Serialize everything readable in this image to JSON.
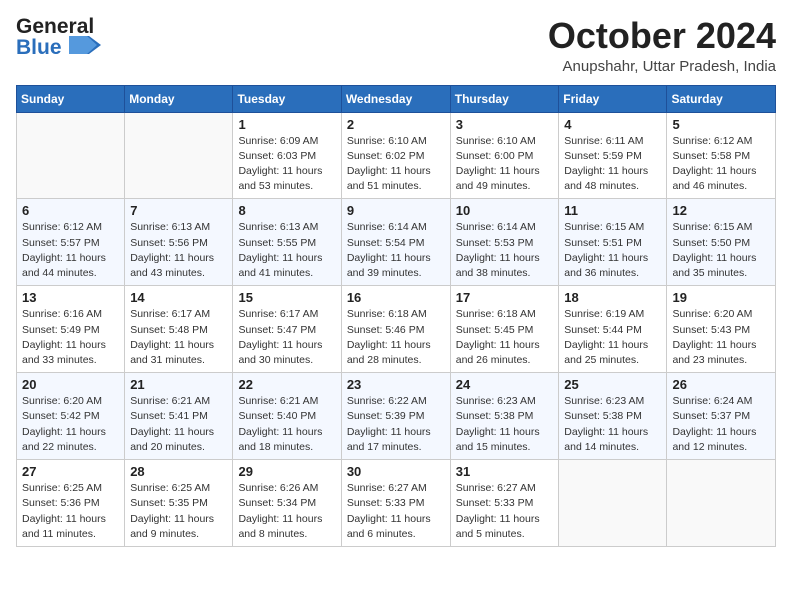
{
  "header": {
    "logo_general": "General",
    "logo_blue": "Blue",
    "month": "October 2024",
    "location": "Anupshahr, Uttar Pradesh, India"
  },
  "weekdays": [
    "Sunday",
    "Monday",
    "Tuesday",
    "Wednesday",
    "Thursday",
    "Friday",
    "Saturday"
  ],
  "weeks": [
    [
      {
        "day": "",
        "info": ""
      },
      {
        "day": "",
        "info": ""
      },
      {
        "day": "1",
        "info": "Sunrise: 6:09 AM\nSunset: 6:03 PM\nDaylight: 11 hours and 53 minutes."
      },
      {
        "day": "2",
        "info": "Sunrise: 6:10 AM\nSunset: 6:02 PM\nDaylight: 11 hours and 51 minutes."
      },
      {
        "day": "3",
        "info": "Sunrise: 6:10 AM\nSunset: 6:00 PM\nDaylight: 11 hours and 49 minutes."
      },
      {
        "day": "4",
        "info": "Sunrise: 6:11 AM\nSunset: 5:59 PM\nDaylight: 11 hours and 48 minutes."
      },
      {
        "day": "5",
        "info": "Sunrise: 6:12 AM\nSunset: 5:58 PM\nDaylight: 11 hours and 46 minutes."
      }
    ],
    [
      {
        "day": "6",
        "info": "Sunrise: 6:12 AM\nSunset: 5:57 PM\nDaylight: 11 hours and 44 minutes."
      },
      {
        "day": "7",
        "info": "Sunrise: 6:13 AM\nSunset: 5:56 PM\nDaylight: 11 hours and 43 minutes."
      },
      {
        "day": "8",
        "info": "Sunrise: 6:13 AM\nSunset: 5:55 PM\nDaylight: 11 hours and 41 minutes."
      },
      {
        "day": "9",
        "info": "Sunrise: 6:14 AM\nSunset: 5:54 PM\nDaylight: 11 hours and 39 minutes."
      },
      {
        "day": "10",
        "info": "Sunrise: 6:14 AM\nSunset: 5:53 PM\nDaylight: 11 hours and 38 minutes."
      },
      {
        "day": "11",
        "info": "Sunrise: 6:15 AM\nSunset: 5:51 PM\nDaylight: 11 hours and 36 minutes."
      },
      {
        "day": "12",
        "info": "Sunrise: 6:15 AM\nSunset: 5:50 PM\nDaylight: 11 hours and 35 minutes."
      }
    ],
    [
      {
        "day": "13",
        "info": "Sunrise: 6:16 AM\nSunset: 5:49 PM\nDaylight: 11 hours and 33 minutes."
      },
      {
        "day": "14",
        "info": "Sunrise: 6:17 AM\nSunset: 5:48 PM\nDaylight: 11 hours and 31 minutes."
      },
      {
        "day": "15",
        "info": "Sunrise: 6:17 AM\nSunset: 5:47 PM\nDaylight: 11 hours and 30 minutes."
      },
      {
        "day": "16",
        "info": "Sunrise: 6:18 AM\nSunset: 5:46 PM\nDaylight: 11 hours and 28 minutes."
      },
      {
        "day": "17",
        "info": "Sunrise: 6:18 AM\nSunset: 5:45 PM\nDaylight: 11 hours and 26 minutes."
      },
      {
        "day": "18",
        "info": "Sunrise: 6:19 AM\nSunset: 5:44 PM\nDaylight: 11 hours and 25 minutes."
      },
      {
        "day": "19",
        "info": "Sunrise: 6:20 AM\nSunset: 5:43 PM\nDaylight: 11 hours and 23 minutes."
      }
    ],
    [
      {
        "day": "20",
        "info": "Sunrise: 6:20 AM\nSunset: 5:42 PM\nDaylight: 11 hours and 22 minutes."
      },
      {
        "day": "21",
        "info": "Sunrise: 6:21 AM\nSunset: 5:41 PM\nDaylight: 11 hours and 20 minutes."
      },
      {
        "day": "22",
        "info": "Sunrise: 6:21 AM\nSunset: 5:40 PM\nDaylight: 11 hours and 18 minutes."
      },
      {
        "day": "23",
        "info": "Sunrise: 6:22 AM\nSunset: 5:39 PM\nDaylight: 11 hours and 17 minutes."
      },
      {
        "day": "24",
        "info": "Sunrise: 6:23 AM\nSunset: 5:38 PM\nDaylight: 11 hours and 15 minutes."
      },
      {
        "day": "25",
        "info": "Sunrise: 6:23 AM\nSunset: 5:38 PM\nDaylight: 11 hours and 14 minutes."
      },
      {
        "day": "26",
        "info": "Sunrise: 6:24 AM\nSunset: 5:37 PM\nDaylight: 11 hours and 12 minutes."
      }
    ],
    [
      {
        "day": "27",
        "info": "Sunrise: 6:25 AM\nSunset: 5:36 PM\nDaylight: 11 hours and 11 minutes."
      },
      {
        "day": "28",
        "info": "Sunrise: 6:25 AM\nSunset: 5:35 PM\nDaylight: 11 hours and 9 minutes."
      },
      {
        "day": "29",
        "info": "Sunrise: 6:26 AM\nSunset: 5:34 PM\nDaylight: 11 hours and 8 minutes."
      },
      {
        "day": "30",
        "info": "Sunrise: 6:27 AM\nSunset: 5:33 PM\nDaylight: 11 hours and 6 minutes."
      },
      {
        "day": "31",
        "info": "Sunrise: 6:27 AM\nSunset: 5:33 PM\nDaylight: 11 hours and 5 minutes."
      },
      {
        "day": "",
        "info": ""
      },
      {
        "day": "",
        "info": ""
      }
    ]
  ]
}
